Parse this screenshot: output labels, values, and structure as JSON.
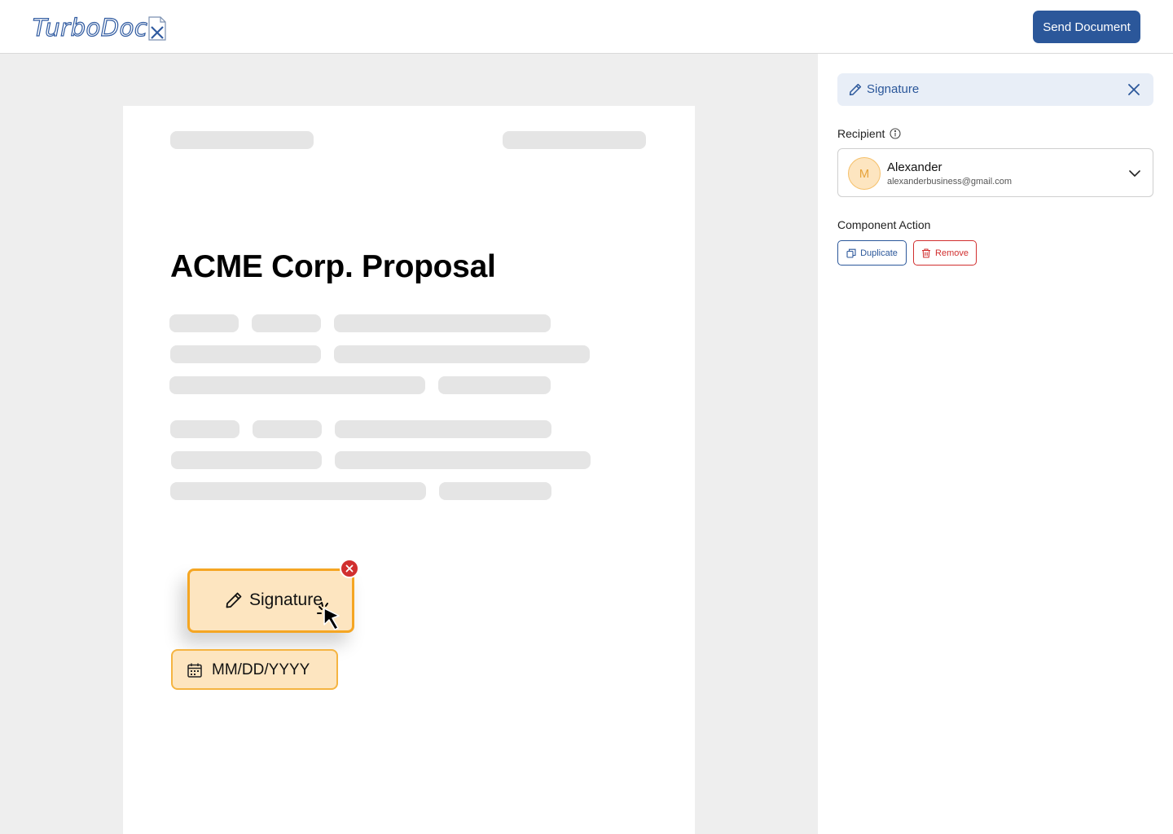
{
  "header": {
    "logo_text": "TurboDoc",
    "send_button": "Send Document"
  },
  "document": {
    "title": "ACME Corp. Proposal",
    "signature_field": {
      "label": "Signature"
    },
    "date_field": {
      "placeholder": "MM/DD/YYYY"
    }
  },
  "panel": {
    "title": "Signature",
    "recipient_label": "Recipient",
    "recipient": {
      "initial": "M",
      "name": "Alexander",
      "email": "alexanderbusiness@gmail.com"
    },
    "component_action_label": "Component Action",
    "duplicate_button": "Duplicate",
    "remove_button": "Remove"
  },
  "colors": {
    "brand": "#2b579a",
    "field_fill": "#fde5c0",
    "field_border": "#f5a623",
    "danger": "#d12f2f"
  }
}
